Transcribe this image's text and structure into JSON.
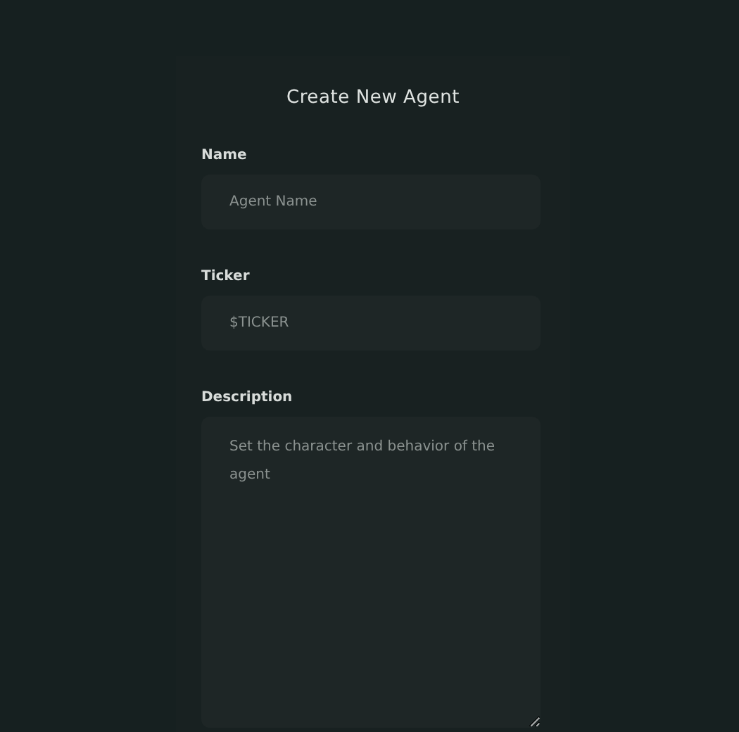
{
  "form": {
    "title": "Create New Agent",
    "fields": [
      {
        "kind": "input",
        "label": "Name",
        "placeholder": "Agent Name"
      },
      {
        "kind": "input",
        "label": "Ticker",
        "placeholder": "$TICKER"
      },
      {
        "kind": "textarea",
        "label": "Description",
        "placeholder": "Set the character and behavior of the agent"
      }
    ]
  }
}
